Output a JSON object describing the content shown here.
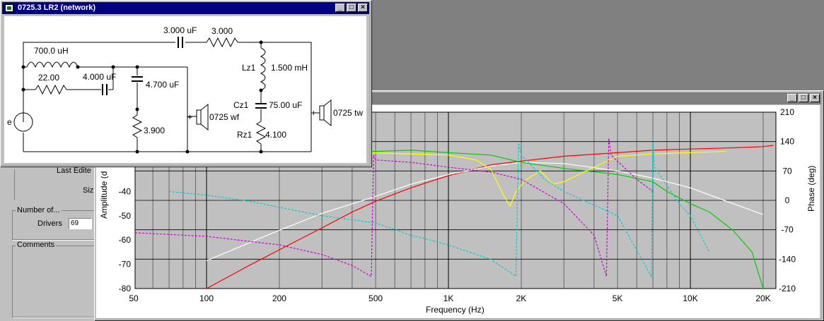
{
  "network_window": {
    "title": "0725.3 LR2 (network)",
    "components": {
      "c1": "3.000 uF",
      "r1": "3.000",
      "l_main": "700.0 uH",
      "r_22": "22.00",
      "c_4": "4.000 uF",
      "c_47": "4.700 uF",
      "r_39": "3.900",
      "woofer": "0725 wf",
      "lz1_name": "Lz1",
      "lz1_val": "1.500 mH",
      "cz1_name": "Cz1",
      "cz1_val": "75.00 uF",
      "rz1_name": "Rz1",
      "rz1_val": "4.100",
      "tweeter": "0725 tw",
      "source": "e",
      "plus_wf": "+",
      "plus_tw": "+"
    }
  },
  "back_panel": {
    "last_edited": "Last Edite",
    "size": "Siz",
    "number_of": "Number of...",
    "drivers_label": "Drivers",
    "drivers_value": "69",
    "comments": "Comments"
  },
  "graph_window": {
    "y_left_label": "Amplitude (d",
    "y_right_label": "Phase (deg)",
    "x_label": "Frequency (Hz)"
  },
  "chart_data": {
    "type": "line",
    "xlabel": "Frequency (Hz)",
    "ylabel": "Amplitude (d",
    "y2label": "Phase (deg)",
    "x_scale": "log",
    "xlim": [
      50,
      25000
    ],
    "ylim": [
      -80,
      0
    ],
    "y2lim": [
      -210,
      210
    ],
    "grid": true,
    "x_ticks": [
      {
        "v": 50,
        "label": "50"
      },
      {
        "v": 100,
        "label": "100"
      },
      {
        "v": 200,
        "label": "200"
      },
      {
        "v": 500,
        "label": "500"
      },
      {
        "v": 1000,
        "label": "1K"
      },
      {
        "v": 2000,
        "label": "2K"
      },
      {
        "v": 5000,
        "label": "5K"
      },
      {
        "v": 10000,
        "label": "10K"
      },
      {
        "v": 20000,
        "label": "20K"
      }
    ],
    "y_ticks_visible": [
      {
        "v": -40,
        "label": "-40"
      },
      {
        "v": -50,
        "label": "-50"
      },
      {
        "v": -60,
        "label": "-60"
      },
      {
        "v": -70,
        "label": "-70"
      },
      {
        "v": -80,
        "label": "-80"
      }
    ],
    "y2_ticks": [
      {
        "v": 210,
        "label": "210"
      },
      {
        "v": 140,
        "label": "140"
      },
      {
        "v": 70,
        "label": "70"
      },
      {
        "v": 0,
        "label": "0"
      },
      {
        "v": -70,
        "label": "-70"
      },
      {
        "v": -140,
        "label": "-140"
      },
      {
        "v": -210,
        "label": "-210"
      }
    ],
    "series": [
      {
        "key": "red",
        "color": "#ff0000",
        "axis": "left",
        "x": [
          100,
          150,
          200,
          300,
          400,
          500,
          700,
          1000,
          1500,
          2000,
          3000,
          5000,
          7000,
          10000,
          15000,
          20000,
          22000
        ],
        "y": [
          -80,
          -70.5,
          -64,
          -55,
          -48.5,
          -44,
          -38.5,
          -33.5,
          -29,
          -27.5,
          -25.5,
          -24,
          -23,
          -22.5,
          -22,
          -21.5,
          -21
        ]
      },
      {
        "key": "white",
        "color": "#ffffff",
        "axis": "left",
        "x": [
          100,
          200,
          300,
          500,
          700,
          1000,
          1500,
          2000,
          3000,
          5000,
          7000,
          10000,
          15000,
          20000
        ],
        "y": [
          -68.5,
          -56,
          -49,
          -42,
          -37,
          -33,
          -29.5,
          -28,
          -28.5,
          -31.5,
          -34.5,
          -38.5,
          -45,
          -49.5
        ]
      },
      {
        "key": "green",
        "color": "#00cc00",
        "axis": "left",
        "x": [
          450,
          500,
          700,
          1000,
          1500,
          2000,
          3000,
          5000,
          7000,
          8000,
          10000,
          12000,
          15000,
          18000,
          20000
        ],
        "y": [
          -23.5,
          -23.5,
          -23,
          -24,
          -25,
          -28,
          -30.5,
          -33,
          -36,
          -40,
          -45,
          -48.5,
          -56,
          -65,
          -80
        ]
      },
      {
        "key": "yellow",
        "color": "#ffff00",
        "axis": "left",
        "x": [
          450,
          700,
          1000,
          1300,
          1500,
          1700,
          1800,
          1900,
          2100,
          2400,
          2700,
          3000,
          4000,
          5000,
          7000,
          10000,
          14000
        ],
        "y": [
          -24,
          -24.5,
          -25,
          -27,
          -31,
          -42,
          -46,
          -40,
          -35,
          -31.5,
          -37,
          -36,
          -30,
          -25.5,
          -24.5,
          -24,
          -23.5
        ]
      },
      {
        "key": "magenta",
        "color": "#cc00cc",
        "axis": "left",
        "dashed": true,
        "x": [
          50,
          100,
          200,
          300,
          400,
          480,
          490,
          500,
          700,
          1000,
          1500,
          2000,
          3000,
          4000,
          4500,
          4600,
          4700,
          6000,
          7000
        ],
        "y": [
          -57,
          -58.5,
          -62,
          -66,
          -70.5,
          -75,
          -25,
          -27,
          -28,
          -30,
          -32,
          -35,
          -45,
          -58,
          -75,
          -18,
          -25,
          -35,
          -40
        ]
      },
      {
        "key": "cyan",
        "color": "#00cccc",
        "axis": "left",
        "dashed": true,
        "x": [
          70,
          100,
          150,
          200,
          300,
          500,
          700,
          1000,
          1500,
          1900,
          1950,
          2000,
          2500,
          3000,
          5000,
          6900,
          7000,
          7100,
          9000,
          10000,
          12000
        ],
        "y": [
          -40,
          -41.5,
          -44,
          -46.5,
          -50,
          -53,
          -58,
          -62,
          -68,
          -75,
          -20,
          -25,
          -35,
          -40,
          -50,
          -75,
          -18,
          -30,
          -45,
          -50,
          -65
        ]
      }
    ]
  }
}
